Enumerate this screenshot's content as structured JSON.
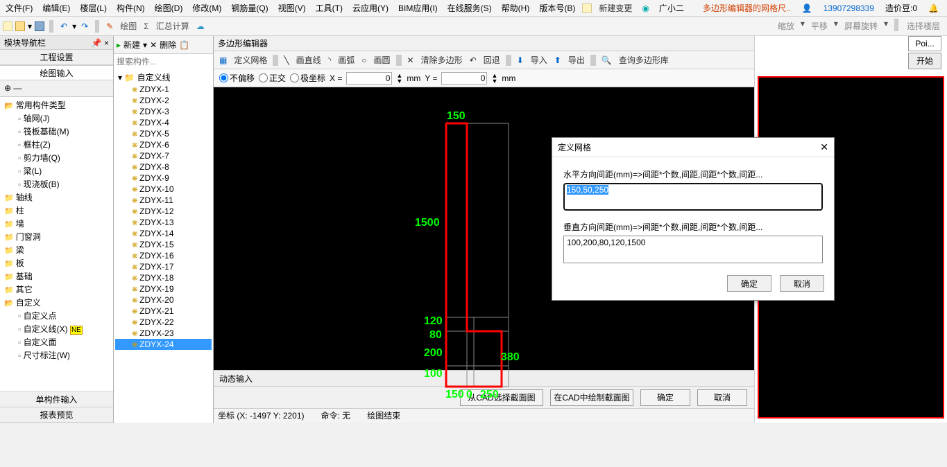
{
  "menu": {
    "items": [
      "文件(F)",
      "编辑(E)",
      "楼层(L)",
      "构件(N)",
      "绘图(D)",
      "修改(M)",
      "钢筋量(Q)",
      "视图(V)",
      "工具(T)",
      "云应用(Y)",
      "BIM应用(I)",
      "在线服务(S)",
      "帮助(H)",
      "版本号(B)"
    ],
    "new_change": "新建变更",
    "assist": "广小二",
    "poly_title": "多边形编辑器的网格尺..",
    "user": "13907298339",
    "coin": "造价豆:0"
  },
  "toolbar2": {
    "draw": "绘图",
    "sum": "汇总计算",
    "zoom": "缩放",
    "pan": "平移",
    "rotate": "屏幕旋转",
    "select_floor": "选择楼层"
  },
  "left": {
    "title": "模块导航栏",
    "tabs": [
      "工程设置",
      "绘图输入"
    ],
    "bottom": [
      "单构件输入",
      "报表预览"
    ],
    "tree": [
      {
        "l": "常用构件类型",
        "d": 1,
        "cls": "fopen"
      },
      {
        "l": "轴网(J)",
        "d": 2,
        "cls": "leaf"
      },
      {
        "l": "筏板基础(M)",
        "d": 2,
        "cls": "leaf"
      },
      {
        "l": "框柱(Z)",
        "d": 2,
        "cls": "leaf"
      },
      {
        "l": "剪力墙(Q)",
        "d": 2,
        "cls": "leaf"
      },
      {
        "l": "梁(L)",
        "d": 2,
        "cls": "leaf"
      },
      {
        "l": "现浇板(B)",
        "d": 2,
        "cls": "leaf"
      },
      {
        "l": "轴线",
        "d": 1,
        "cls": "folder"
      },
      {
        "l": "柱",
        "d": 1,
        "cls": "folder"
      },
      {
        "l": "墙",
        "d": 1,
        "cls": "folder"
      },
      {
        "l": "门窗洞",
        "d": 1,
        "cls": "folder"
      },
      {
        "l": "梁",
        "d": 1,
        "cls": "folder"
      },
      {
        "l": "板",
        "d": 1,
        "cls": "folder"
      },
      {
        "l": "基础",
        "d": 1,
        "cls": "folder"
      },
      {
        "l": "其它",
        "d": 1,
        "cls": "folder"
      },
      {
        "l": "自定义",
        "d": 1,
        "cls": "fopen"
      },
      {
        "l": "自定义点",
        "d": 2,
        "cls": "leaf"
      },
      {
        "l": "自定义线(X)",
        "d": 2,
        "cls": "leaf selline",
        "badge": "NE"
      },
      {
        "l": "自定义面",
        "d": 2,
        "cls": "leaf"
      },
      {
        "l": "尺寸标注(W)",
        "d": 2,
        "cls": "leaf"
      }
    ]
  },
  "comp": {
    "new": "新建",
    "del": "删除",
    "search_ph": "搜索构件...",
    "header": "自定义线",
    "items": [
      "ZDYX-1",
      "ZDYX-2",
      "ZDYX-3",
      "ZDYX-4",
      "ZDYX-5",
      "ZDYX-6",
      "ZDYX-7",
      "ZDYX-8",
      "ZDYX-9",
      "ZDYX-10",
      "ZDYX-11",
      "ZDYX-12",
      "ZDYX-13",
      "ZDYX-14",
      "ZDYX-15",
      "ZDYX-16",
      "ZDYX-17",
      "ZDYX-18",
      "ZDYX-19",
      "ZDYX-20",
      "ZDYX-21",
      "ZDYX-22",
      "ZDYX-23",
      "ZDYX-24"
    ],
    "selected": "ZDYX-24"
  },
  "editor": {
    "title": "多边形编辑器",
    "tb": {
      "grid": "定义网格",
      "line": "画直线",
      "arc": "画弧",
      "circle": "画圆",
      "clear": "清除多边形",
      "undo": "回退",
      "import": "导入",
      "export": "导出",
      "query": "查询多边形库"
    },
    "radio": {
      "offset": "不偏移",
      "ortho": "正交",
      "polar": "极坐标"
    },
    "xlabel": "X =",
    "ylabel": "Y =",
    "xval": "0",
    "yval": "0",
    "unit": "mm",
    "dims": {
      "top": "150",
      "left": "1500",
      "l120": "120",
      "l80": "80",
      "l200": "200",
      "l100": "100",
      "r380": "380",
      "b150": "150",
      "b0": "0",
      "b250": "250"
    },
    "dyn": "动态输入",
    "btns": {
      "cad_sel": "从CAD选择截面图",
      "cad_draw": "在CAD中绘制截面图",
      "ok": "确定",
      "cancel": "取消"
    },
    "status": {
      "coord": "坐标 (X: -1497 Y: 2201)",
      "cmd": "命令: 无",
      "draw": "绘图结束"
    }
  },
  "right": {
    "poi": "Poi...",
    "start": "开始"
  },
  "dlg": {
    "title": "定义网格",
    "h_lbl": "水平方向间距(mm)=>间距*个数,间距,间距*个数,间距...",
    "h_val": "150,50,250",
    "v_lbl": "垂直方向间距(mm)=>间距*个数,间距,间距*个数,间距...",
    "v_val": "100,200,80,120,1500",
    "ok": "确定",
    "cancel": "取消"
  }
}
